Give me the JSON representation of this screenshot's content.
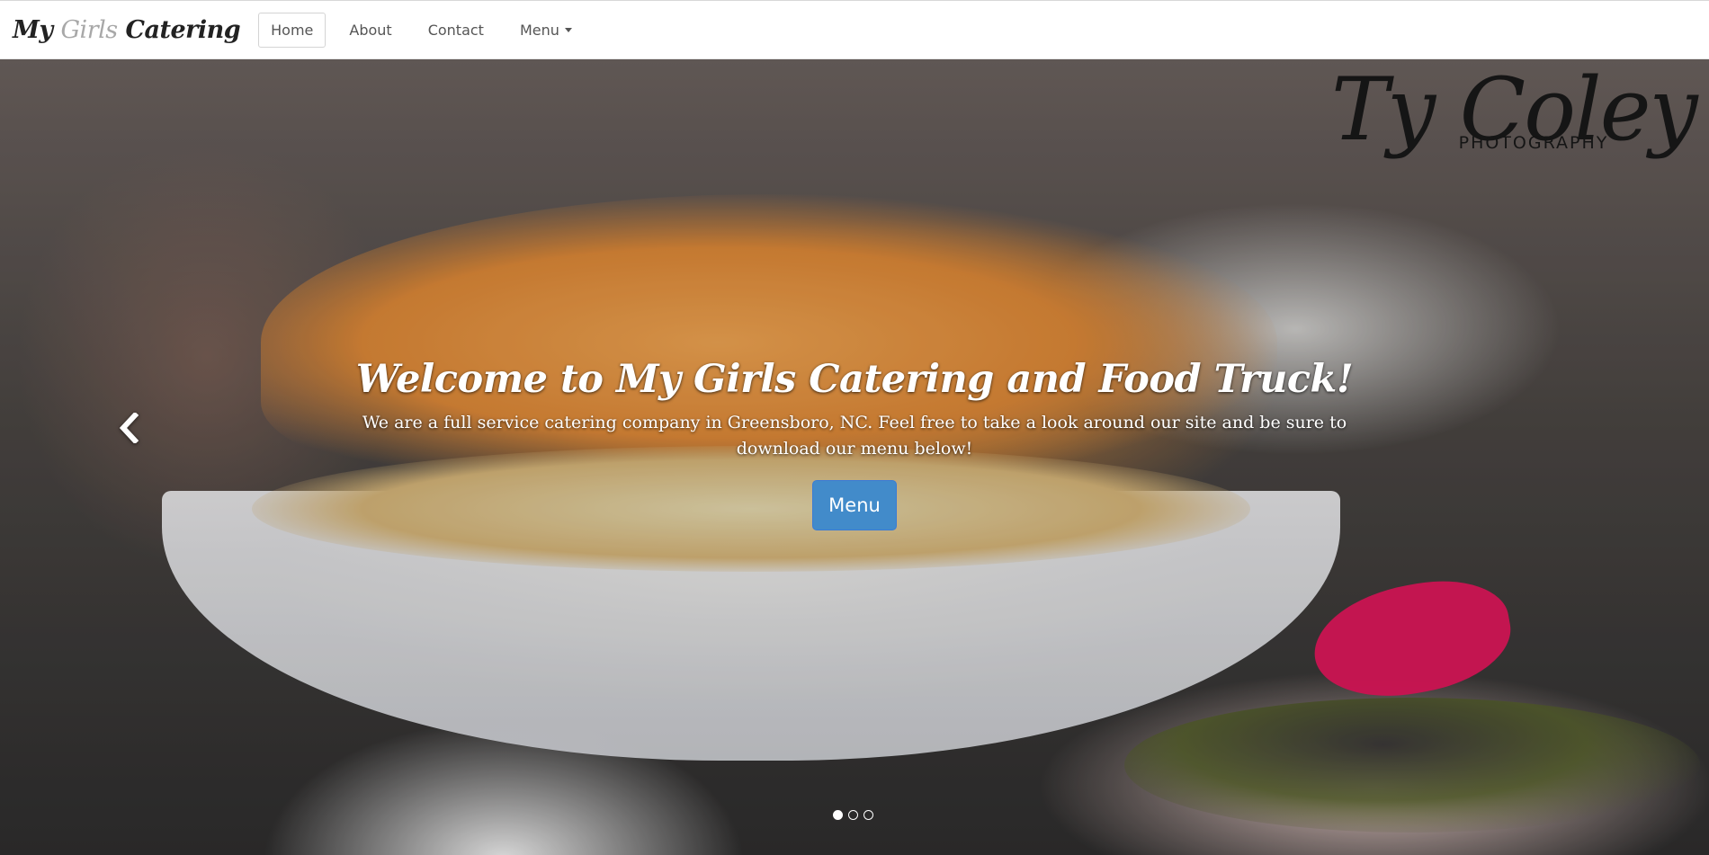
{
  "brand": {
    "part1": "My ",
    "part2": "Girls",
    "part3": " Catering"
  },
  "nav": {
    "items": [
      {
        "label": "Home",
        "active": true
      },
      {
        "label": "About",
        "active": false
      },
      {
        "label": "Contact",
        "active": false
      },
      {
        "label": "Menu",
        "dropdown": true,
        "active": false
      }
    ]
  },
  "hero": {
    "watermark": {
      "script": "Ty Coley",
      "sub": "PHOTOGRAPHY"
    },
    "title": "Welcome to My Girls Catering and Food Truck!",
    "text": "We are a full service catering company in Greensboro, NC. Feel free to take a look around our site and be sure to download our menu below!",
    "button_label": "Menu",
    "prev_icon": "chevron-left-icon",
    "slides_total": 3,
    "slide_active": 1
  },
  "colors": {
    "button": "#428bca",
    "navbar_bg": "#ffffff",
    "text_nav": "#555555"
  }
}
